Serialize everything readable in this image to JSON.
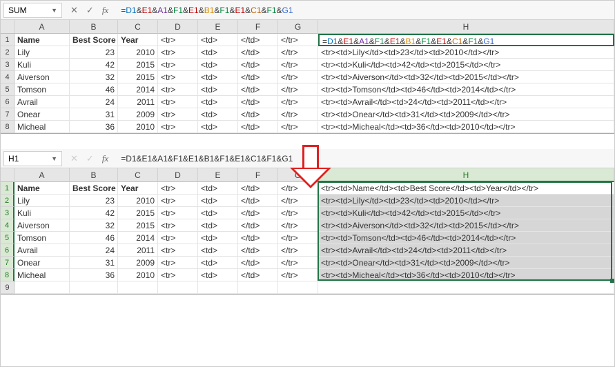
{
  "top": {
    "name_box": "SUM",
    "formula_plain": "=D1&E1&A1&F1&E1&B1&F1&E1&C1&F1&G1",
    "formula_tokens": [
      {
        "t": "=",
        "c": ""
      },
      {
        "t": "D1",
        "c": "D1"
      },
      {
        "t": "&",
        "c": ""
      },
      {
        "t": "E1",
        "c": "E1"
      },
      {
        "t": "&",
        "c": ""
      },
      {
        "t": "A1",
        "c": "A1"
      },
      {
        "t": "&",
        "c": ""
      },
      {
        "t": "F1",
        "c": "F1"
      },
      {
        "t": "&",
        "c": ""
      },
      {
        "t": "E1",
        "c": "E1"
      },
      {
        "t": "&",
        "c": ""
      },
      {
        "t": "B1",
        "c": "B1"
      },
      {
        "t": "&",
        "c": ""
      },
      {
        "t": "F1",
        "c": "F1"
      },
      {
        "t": "&",
        "c": ""
      },
      {
        "t": "E1",
        "c": "E1"
      },
      {
        "t": "&",
        "c": ""
      },
      {
        "t": "C1",
        "c": "C1"
      },
      {
        "t": "&",
        "c": ""
      },
      {
        "t": "F1",
        "c": "F1"
      },
      {
        "t": "&",
        "c": ""
      },
      {
        "t": "G1",
        "c": "G1"
      }
    ],
    "cols": [
      "",
      "A",
      "B",
      "C",
      "D",
      "E",
      "F",
      "G",
      "H"
    ],
    "rows": [
      {
        "n": "1",
        "A": "Name",
        "B": "Best Score",
        "C": "Year",
        "D": "<tr>",
        "E": "<td>",
        "F": "</td>",
        "G": "</tr>",
        "H_is_formula": true
      },
      {
        "n": "2",
        "A": "Lily",
        "B": "23",
        "C": "2010",
        "D": "<tr>",
        "E": "<td>",
        "F": "</td>",
        "G": "</tr>",
        "H": "<tr><td>Lily</td><td>23</td><td>2010</td></tr>"
      },
      {
        "n": "3",
        "A": "Kuli",
        "B": "42",
        "C": "2015",
        "D": "<tr>",
        "E": "<td>",
        "F": "</td>",
        "G": "</tr>",
        "H": "<tr><td>Kuli</td><td>42</td><td>2015</td></tr>"
      },
      {
        "n": "4",
        "A": "Aiverson",
        "B": "32",
        "C": "2015",
        "D": "<tr>",
        "E": "<td>",
        "F": "</td>",
        "G": "</tr>",
        "H": "<tr><td>Aiverson</td><td>32</td><td>2015</td></tr>"
      },
      {
        "n": "5",
        "A": "Tomson",
        "B": "46",
        "C": "2014",
        "D": "<tr>",
        "E": "<td>",
        "F": "</td>",
        "G": "</tr>",
        "H": "<tr><td>Tomson</td><td>46</td><td>2014</td></tr>"
      },
      {
        "n": "6",
        "A": "Avrail",
        "B": "24",
        "C": "2011",
        "D": "<tr>",
        "E": "<td>",
        "F": "</td>",
        "G": "</tr>",
        "H": "<tr><td>Avrail</td><td>24</td><td>2011</td></tr>"
      },
      {
        "n": "7",
        "A": "Onear",
        "B": "31",
        "C": "2009",
        "D": "<tr>",
        "E": "<td>",
        "F": "</td>",
        "G": "</tr>",
        "H": "<tr><td>Onear</td><td>31</td><td>2009</td></tr>"
      },
      {
        "n": "8",
        "A": "Micheal",
        "B": "36",
        "C": "2010",
        "D": "<tr>",
        "E": "<td>",
        "F": "</td>",
        "G": "</tr>",
        "H": "<tr><td>Micheal</td><td>36</td><td>2010</td></tr>"
      }
    ],
    "ref_boxes": {
      "A1": "#7030a0",
      "B1": "#d88b00",
      "C1": "#c06000",
      "D1": "#0070c0",
      "E1": "#c00000",
      "F1": "#00863d",
      "G1": "#3366cc"
    }
  },
  "bottom": {
    "name_box": "H1",
    "formula_plain": "=D1&E1&A1&F1&E1&B1&F1&E1&C1&F1&G1",
    "cols": [
      "",
      "A",
      "B",
      "C",
      "D",
      "E",
      "F",
      "G",
      "H"
    ],
    "rows": [
      {
        "n": "1",
        "A": "Name",
        "B": "Best Score",
        "C": "Year",
        "D": "<tr>",
        "E": "<td>",
        "F": "</td>",
        "G": "</tr>",
        "H": "<tr><td>Name</td><td>Best Score</td><td>Year</td></tr>"
      },
      {
        "n": "2",
        "A": "Lily",
        "B": "23",
        "C": "2010",
        "D": "<tr>",
        "E": "<td>",
        "F": "</td>",
        "G": "</tr>",
        "H": "<tr><td>Lily</td><td>23</td><td>2010</td></tr>"
      },
      {
        "n": "3",
        "A": "Kuli",
        "B": "42",
        "C": "2015",
        "D": "<tr>",
        "E": "<td>",
        "F": "</td>",
        "G": "</tr>",
        "H": "<tr><td>Kuli</td><td>42</td><td>2015</td></tr>"
      },
      {
        "n": "4",
        "A": "Aiverson",
        "B": "32",
        "C": "2015",
        "D": "<tr>",
        "E": "<td>",
        "F": "</td>",
        "G": "</tr>",
        "H": "<tr><td>Aiverson</td><td>32</td><td>2015</td></tr>"
      },
      {
        "n": "5",
        "A": "Tomson",
        "B": "46",
        "C": "2014",
        "D": "<tr>",
        "E": "<td>",
        "F": "</td>",
        "G": "</tr>",
        "H": "<tr><td>Tomson</td><td>46</td><td>2014</td></tr>"
      },
      {
        "n": "6",
        "A": "Avrail",
        "B": "24",
        "C": "2011",
        "D": "<tr>",
        "E": "<td>",
        "F": "</td>",
        "G": "</tr>",
        "H": "<tr><td>Avrail</td><td>24</td><td>2011</td></tr>"
      },
      {
        "n": "7",
        "A": "Onear",
        "B": "31",
        "C": "2009",
        "D": "<tr>",
        "E": "<td>",
        "F": "</td>",
        "G": "</tr>",
        "H": "<tr><td>Onear</td><td>31</td><td>2009</td></tr>"
      },
      {
        "n": "8",
        "A": "Micheal",
        "B": "36",
        "C": "2010",
        "D": "<tr>",
        "E": "<td>",
        "F": "</td>",
        "G": "</tr>",
        "H": "<tr><td>Micheal</td><td>36</td><td>2010</td></tr>"
      },
      {
        "n": "9",
        "A": "",
        "B": "",
        "C": "",
        "D": "",
        "E": "",
        "F": "",
        "G": "",
        "H": ""
      }
    ],
    "selection": {
      "col": "H",
      "from": 1,
      "to": 8
    }
  }
}
